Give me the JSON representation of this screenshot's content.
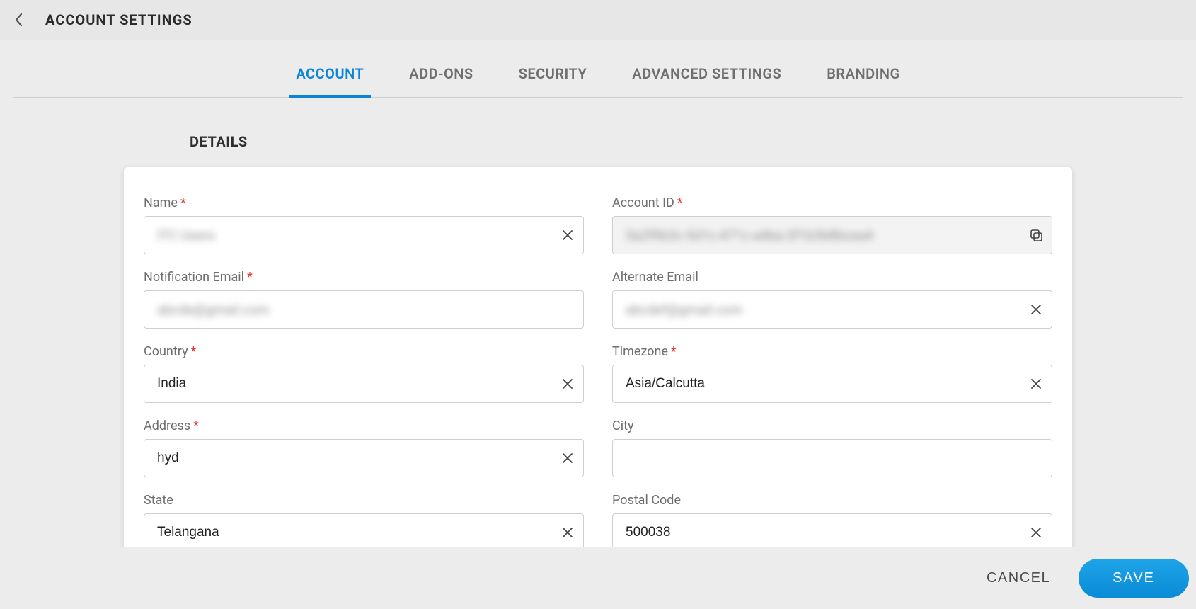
{
  "header": {
    "title": "ACCOUNT SETTINGS"
  },
  "tabs": [
    {
      "label": "ACCOUNT",
      "active": true
    },
    {
      "label": "ADD-ONS",
      "active": false
    },
    {
      "label": "SECURITY",
      "active": false
    },
    {
      "label": "ADVANCED SETTINGS",
      "active": false
    },
    {
      "label": "BRANDING",
      "active": false
    }
  ],
  "section_heading": "DETAILS",
  "form": {
    "name": {
      "label": "Name",
      "required": true,
      "value": "ITC Users",
      "redacted": true
    },
    "account_id": {
      "label": "Account ID",
      "required": true,
      "value": "5a2f9b3c-5d1c-471c-a4ba-3f1b3b8bcea4",
      "redacted": true
    },
    "notification_email": {
      "label": "Notification Email",
      "required": true,
      "value": "abcde@gmail.com",
      "redacted": true
    },
    "alternate_email": {
      "label": "Alternate Email",
      "required": false,
      "value": "abcdef@gmail.com",
      "redacted": true
    },
    "country": {
      "label": "Country",
      "required": true,
      "value": "India"
    },
    "timezone": {
      "label": "Timezone",
      "required": true,
      "value": "Asia/Calcutta"
    },
    "address": {
      "label": "Address",
      "required": true,
      "value": "hyd"
    },
    "city": {
      "label": "City",
      "required": false,
      "value": ""
    },
    "state": {
      "label": "State",
      "required": false,
      "value": "Telangana"
    },
    "postal_code": {
      "label": "Postal Code",
      "required": false,
      "value": "500038"
    }
  },
  "footer": {
    "cancel_label": "CANCEL",
    "save_label": "SAVE"
  }
}
